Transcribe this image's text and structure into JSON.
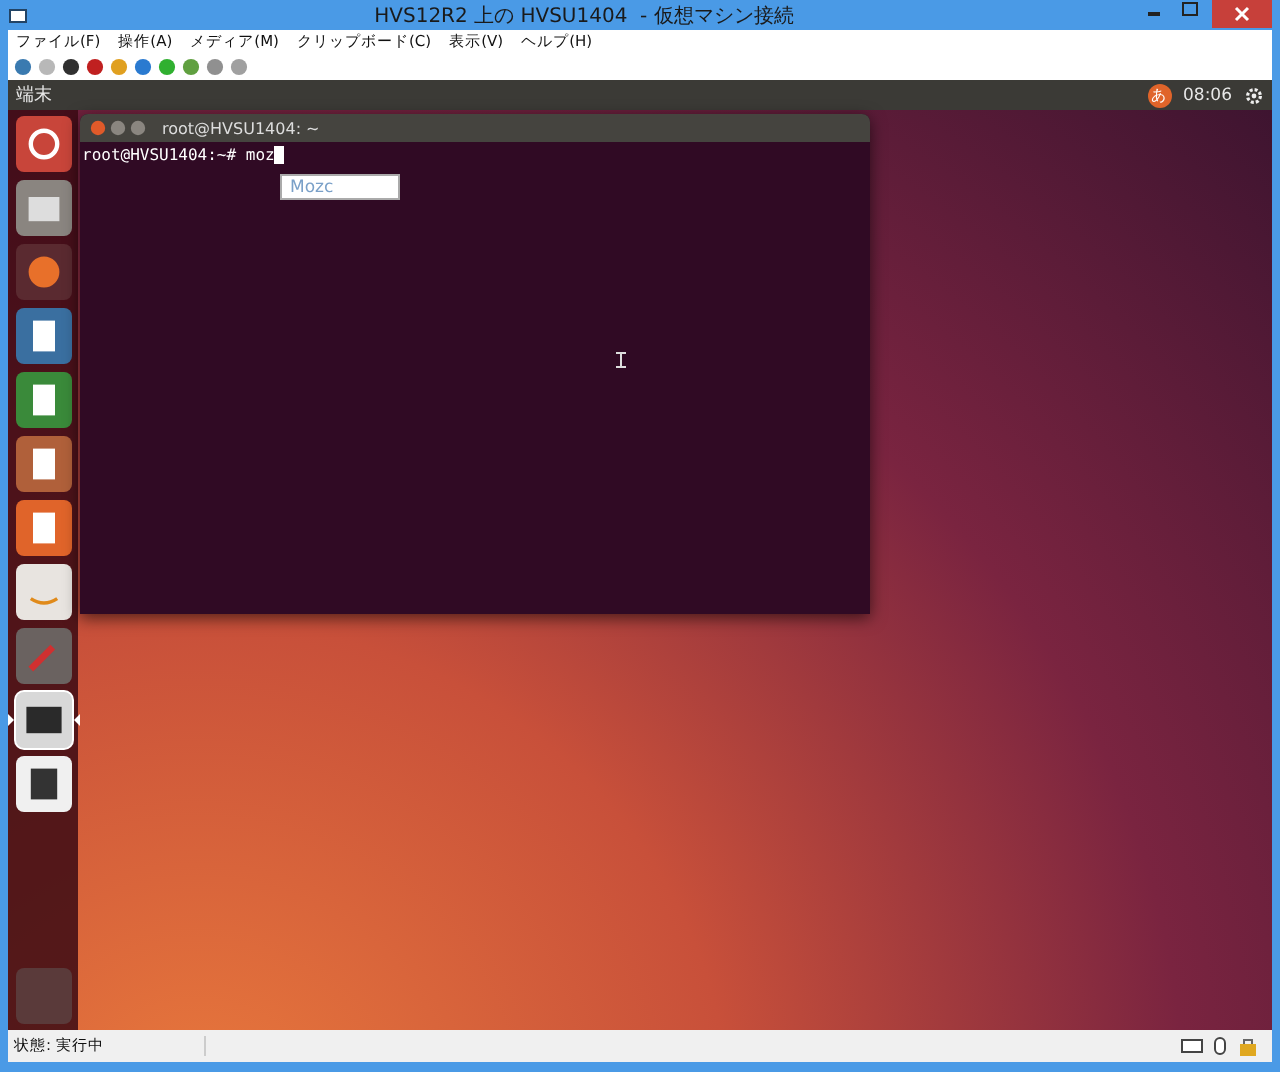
{
  "window": {
    "title": "HVS12R2 上の HVSU1404  - 仮想マシン接続"
  },
  "menu": [
    "ファイル(F)",
    "操作(A)",
    "メディア(M)",
    "クリップボード(C)",
    "表示(V)",
    "ヘルプ(H)"
  ],
  "ubuntu_panel": {
    "app_name": "端末",
    "input_method": "あ",
    "time": "08:06"
  },
  "launcher": [
    {
      "kind": "home",
      "running": false
    },
    {
      "kind": "files",
      "running": false
    },
    {
      "kind": "browser",
      "running": false
    },
    {
      "kind": "writer",
      "running": false
    },
    {
      "kind": "calc",
      "running": false
    },
    {
      "kind": "impress",
      "running": false
    },
    {
      "kind": "software",
      "running": false
    },
    {
      "kind": "shop",
      "running": false
    },
    {
      "kind": "settings",
      "running": false
    },
    {
      "kind": "terminal",
      "running": true
    },
    {
      "kind": "disk",
      "running": false
    }
  ],
  "terminal": {
    "title": "root@HVSU1404: ~",
    "prompt": "root@HVSU1404:~# ",
    "input": "moz"
  },
  "ime_candidate": {
    "text": "Mozc"
  },
  "status_bar": {
    "text": "状態: 実行中"
  }
}
